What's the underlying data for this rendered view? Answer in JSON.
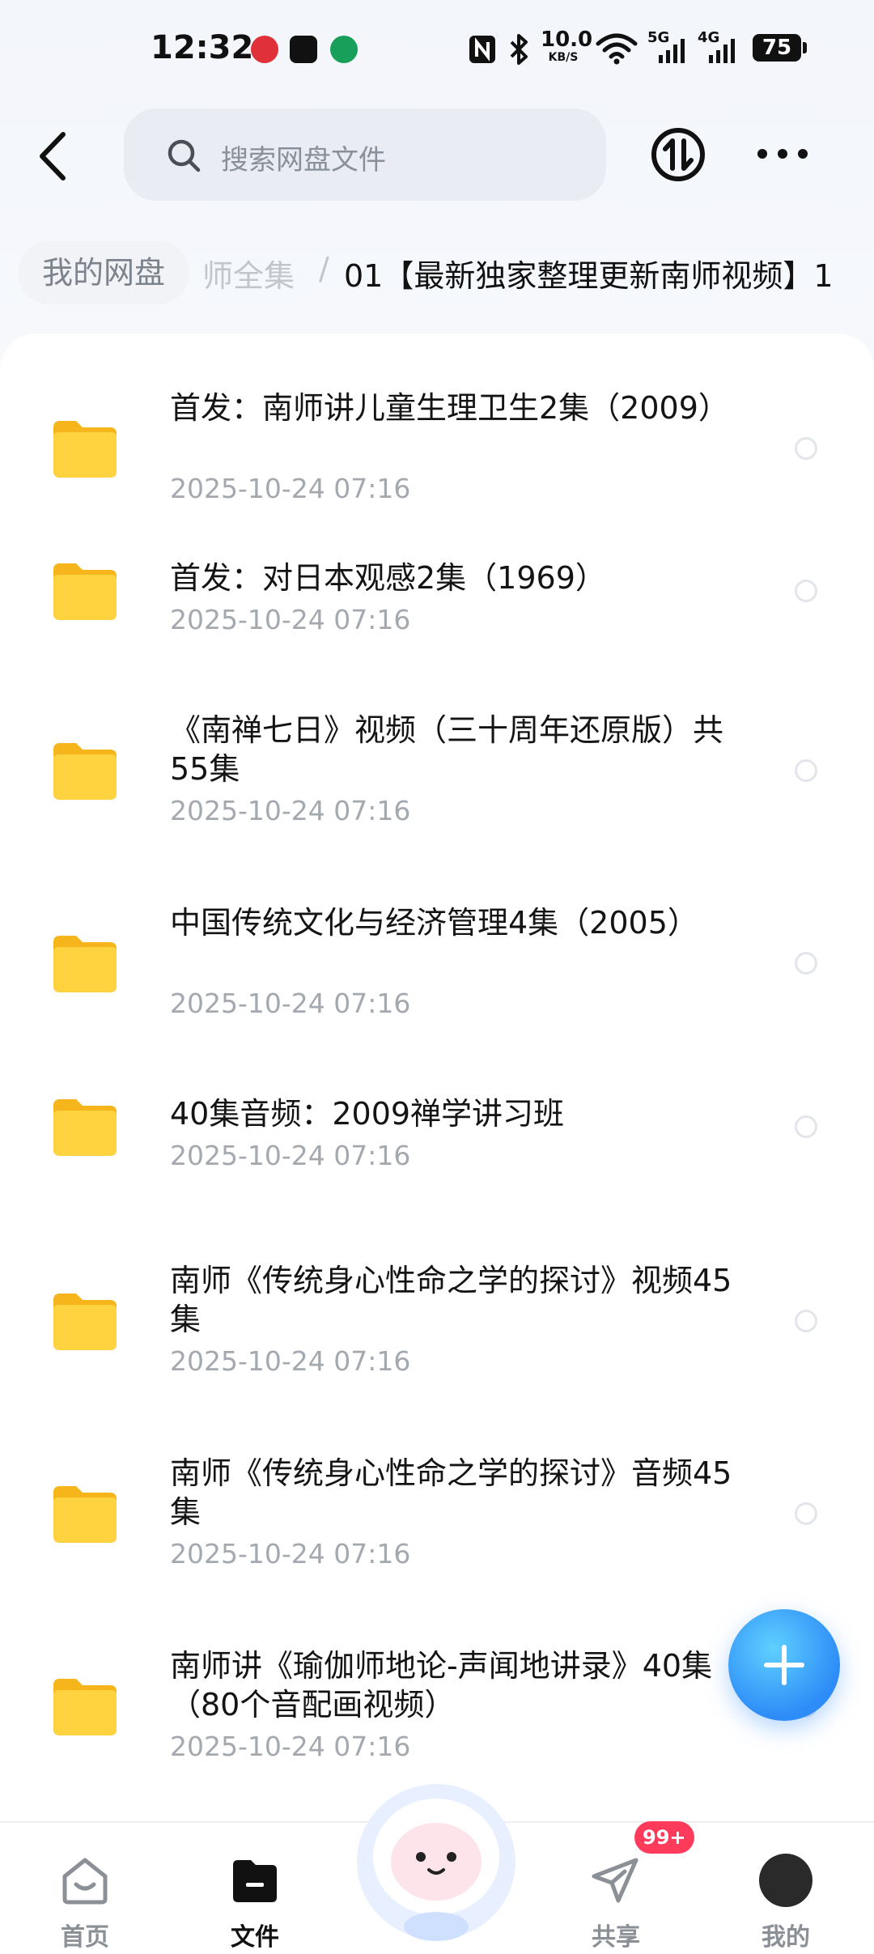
{
  "status_bar": {
    "time": "12:32",
    "network_speed_value": "10.0",
    "network_speed_unit": "KB/S",
    "signal_1": "5G",
    "signal_2": "4G",
    "battery": "75"
  },
  "header": {
    "search_placeholder": "搜索网盘文件"
  },
  "breadcrumb": {
    "home": "我的网盘",
    "middle": "师全集",
    "separator": "/",
    "current": "01【最新独家整理更新南师视频】1"
  },
  "files": [
    {
      "name": "首发：南师讲儿童生理卫生2集（2009）",
      "date": "2025-10-24  07:16"
    },
    {
      "name": "首发：对日本观感2集（1969）",
      "date": "2025-10-24  07:16"
    },
    {
      "name": "《南禅七日》视频（三十周年还原版）共55集",
      "date": "2025-10-24  07:16"
    },
    {
      "name": "中国传统文化与经济管理4集（2005）",
      "date": "2025-10-24  07:16"
    },
    {
      "name": "40集音频：2009禅学讲习班",
      "date": "2025-10-24  07:16"
    },
    {
      "name": "南师《传统身心性命之学的探讨》视频45集",
      "date": "2025-10-24  07:16"
    },
    {
      "name": "南师《传统身心性命之学的探讨》音频45集",
      "date": "2025-10-24  07:16"
    },
    {
      "name": "南师讲《瑜伽师地论-声闻地讲录》40集（80个音配画视频）",
      "date": "2025-10-24  07:16"
    }
  ],
  "bottom_nav": {
    "home": "首页",
    "files": "文件",
    "share": "共享",
    "share_badge": "99+",
    "mine": "我的"
  },
  "colors": {
    "accent": "#2d8cf7",
    "folder": "#ffc933",
    "badge": "#ff3b5c"
  },
  "icons": [
    "back-arrow-icon",
    "search-icon",
    "transfer-icon",
    "more-icon",
    "folder-icon",
    "plus-icon",
    "home-icon",
    "files-icon",
    "share-icon",
    "avatar"
  ]
}
